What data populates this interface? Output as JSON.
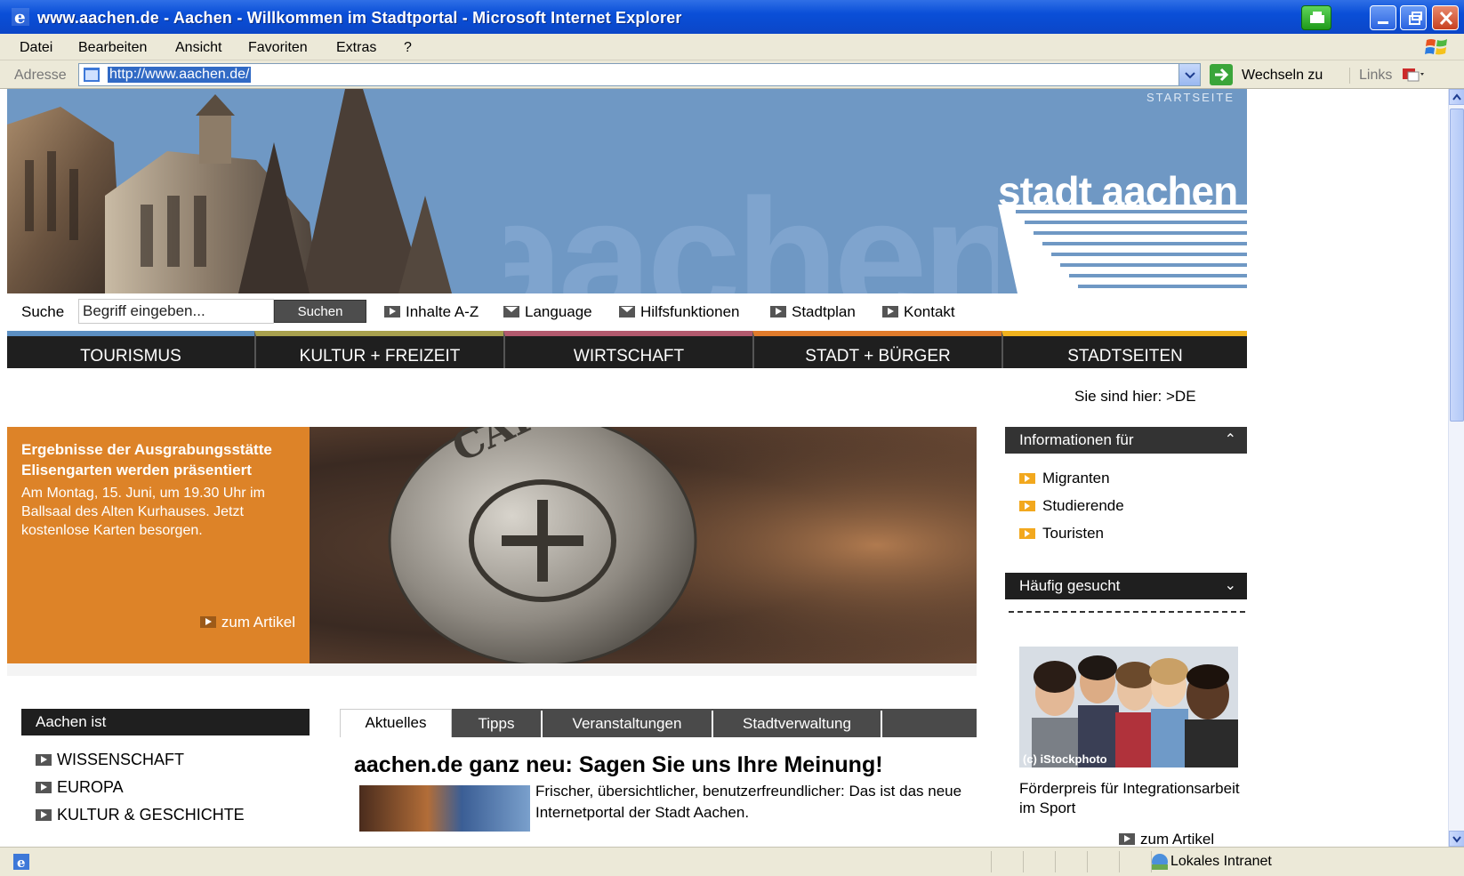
{
  "window": {
    "title": "www.aachen.de - Aachen - Willkommen im Stadtportal - Microsoft Internet Explorer"
  },
  "menu": {
    "items": [
      "Datei",
      "Bearbeiten",
      "Ansicht",
      "Favoriten",
      "Extras",
      "?"
    ]
  },
  "address_bar": {
    "label": "Adresse",
    "url": "http://www.aachen.de/",
    "go_label": "Wechseln zu",
    "links_label": "Links"
  },
  "header": {
    "startseite": "STARTSEITE",
    "brand": "stadt aachen",
    "watermark": "aachen"
  },
  "search": {
    "label": "Suche",
    "placeholder": "Begriff eingeben...",
    "button": "Suchen"
  },
  "toollinks": [
    {
      "label": "Inhalte A-Z",
      "icon": "arrow-icon"
    },
    {
      "label": "Language",
      "icon": "envelope-icon"
    },
    {
      "label": "Hilfsfunktionen",
      "icon": "envelope-icon"
    },
    {
      "label": "Stadtplan",
      "icon": "arrow-icon"
    },
    {
      "label": "Kontakt",
      "icon": "arrow-icon"
    }
  ],
  "mainnav": [
    {
      "label": "TOURISMUS",
      "color": "#5c8fc2"
    },
    {
      "label": "KULTUR + FREIZEIT",
      "color": "#a8a04e"
    },
    {
      "label": "WIRTSCHAFT",
      "color": "#b25a6e"
    },
    {
      "label": "STADT + BÜRGER",
      "color": "#e07b2b"
    },
    {
      "label": "STADTSEITEN",
      "color": "#f0b21e"
    }
  ],
  "breadcrumb": "Sie sind hier: >DE",
  "teaser": {
    "title": "Ergebnisse der Ausgrabungsstätte Elisengarten werden präsentiert",
    "body": "Am Montag, 15. Juni, um 19.30 Uhr im Ballsaal des Alten Kurhauses. Jetzt kostenlose Karten besorgen.",
    "more": "zum Artikel",
    "coin_text": "CAROLVS"
  },
  "aachen_ist": {
    "heading": "Aachen ist",
    "items": [
      "WISSENSCHAFT",
      "EUROPA",
      "KULTUR & GESCHICHTE"
    ]
  },
  "tabs": [
    "Aktuelles",
    "Tipps",
    "Veranstaltungen",
    "Stadtverwaltung"
  ],
  "news": {
    "title": "aachen.de ganz neu: Sagen Sie uns Ihre Meinung!",
    "body": "Frischer, übersichtlicher, benutzerfreundlicher: Das ist das neue Internetportal der Stadt Aachen."
  },
  "sidebar": {
    "info_heading": "Informationen für",
    "info_items": [
      "Migranten",
      "Studierende",
      "Touristen"
    ],
    "haeufig_heading": "Häufig gesucht",
    "photo_credit": "(c) iStockphoto",
    "promo_text": "Förderpreis für Integrationsarbeit im Sport",
    "promo_more": "zum Artikel"
  },
  "status": {
    "zone": "Lokales Intranet"
  },
  "colors": {
    "titlebar": "#0a4fd8",
    "header_blue": "#6f98c4",
    "teaser_orange": "#dd8328",
    "nav_dark": "#1f1f1f"
  }
}
